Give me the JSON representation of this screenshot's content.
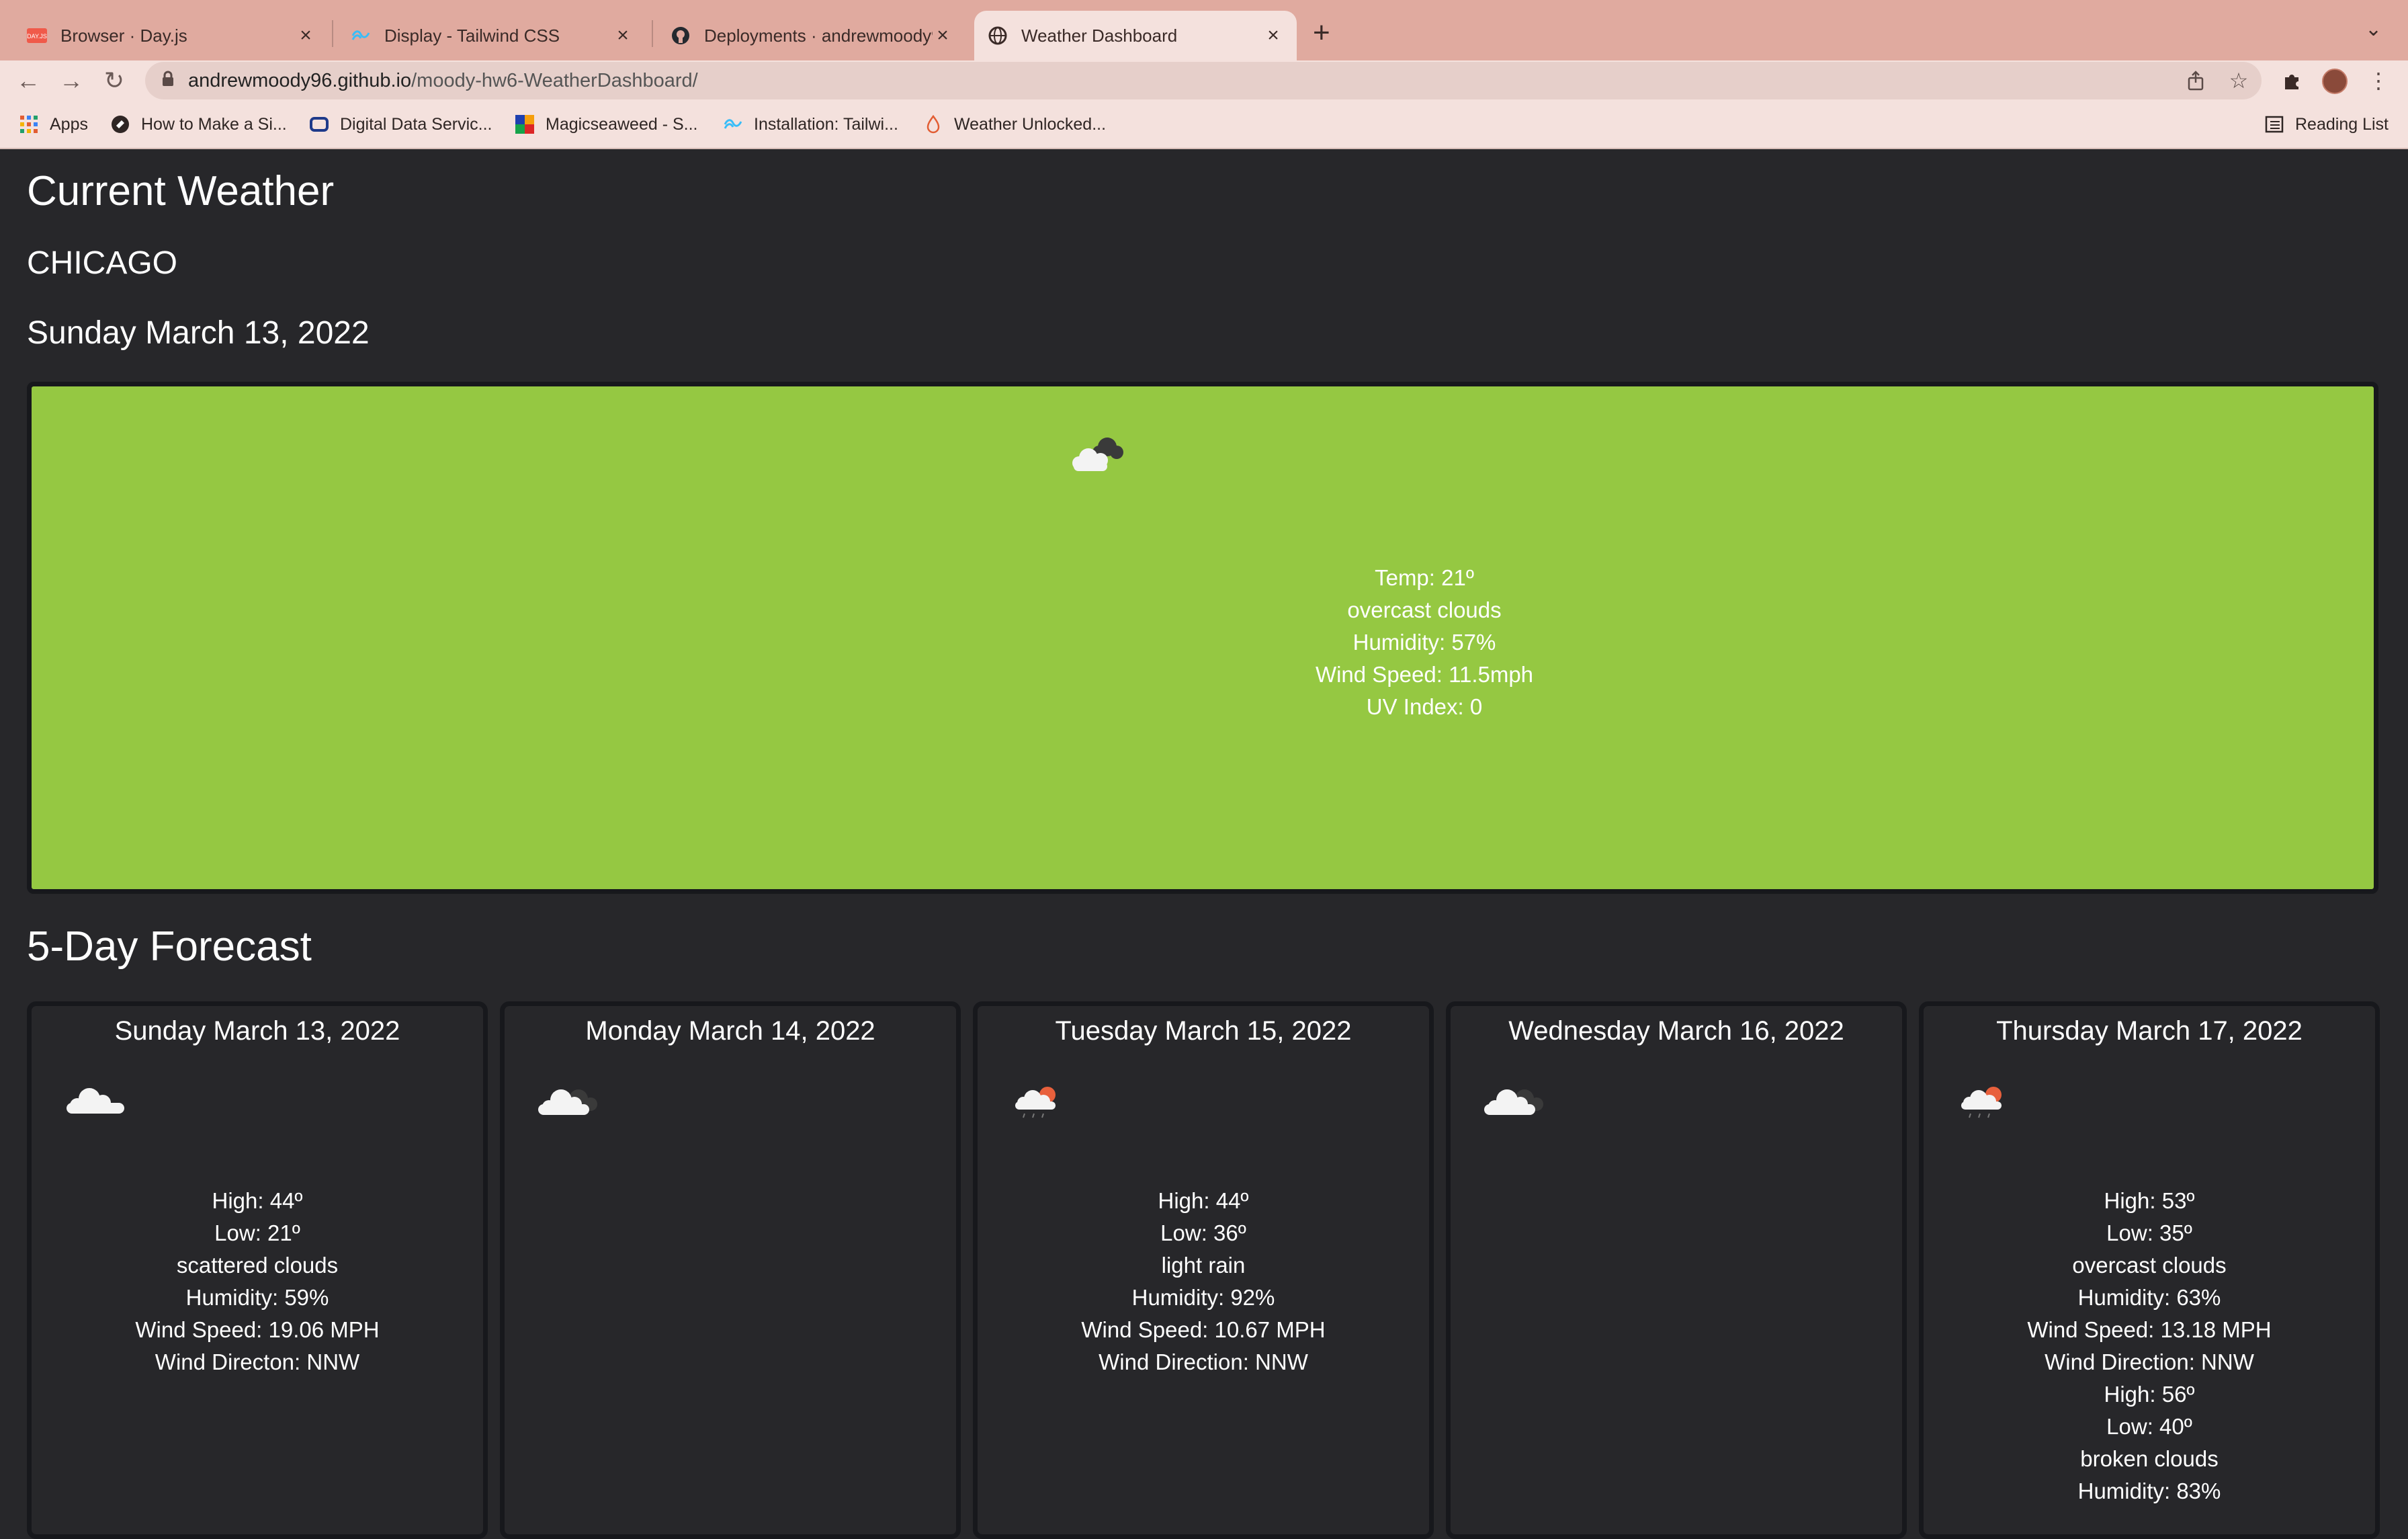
{
  "browser": {
    "tabs": [
      {
        "title": "Browser · Day.js",
        "favicon": "dayjs-icon"
      },
      {
        "title": "Display - Tailwind CSS",
        "favicon": "tailwind-icon"
      },
      {
        "title": "Deployments · andrewmoody96",
        "favicon": "github-icon"
      },
      {
        "title": "Weather Dashboard",
        "favicon": "globe-icon",
        "active": true
      }
    ],
    "url_host": "andrewmoody96.github.io",
    "url_path": "/moody-hw6-WeatherDashboard/",
    "bookmarks": [
      {
        "label": "Apps",
        "icon": "apps-grid-icon"
      },
      {
        "label": "How to Make a Si...",
        "icon": "squarespace-icon"
      },
      {
        "label": "Digital Data Servic...",
        "icon": "ddsi-icon"
      },
      {
        "label": "Magicseaweed - S...",
        "icon": "magicseaweed-icon"
      },
      {
        "label": "Installation: Tailwi...",
        "icon": "tailwind-icon"
      },
      {
        "label": "Weather Unlocked...",
        "icon": "weather-unlocked-icon"
      }
    ],
    "reading_list": "Reading List"
  },
  "page": {
    "heading": "Current Weather",
    "city": "CHICAGO",
    "date": "Sunday March 13, 2022",
    "current": {
      "icon": "overcast-clouds-icon",
      "temp": "Temp: 21º",
      "description": "overcast clouds",
      "humidity": "Humidity: 57%",
      "wind": "Wind Speed: 11.5mph",
      "uv": "UV Index: 0"
    },
    "forecast_heading": "5-Day Forecast",
    "forecast": [
      {
        "date": "Sunday March 13, 2022",
        "icon": "scattered-clouds-icon",
        "lines": [
          "High: 44º",
          "Low: 21º",
          "scattered clouds",
          "Humidity: 59%",
          "Wind Speed: 19.06 MPH",
          "Wind Directon: NNW"
        ]
      },
      {
        "date": "Monday March 14, 2022",
        "icon": "overcast-clouds-icon",
        "lines": []
      },
      {
        "date": "Tuesday March 15, 2022",
        "icon": "light-rain-icon",
        "lines": [
          "High: 44º",
          "Low: 36º",
          "light rain",
          "Humidity: 92%",
          "Wind Speed: 10.67 MPH",
          "Wind Direction: NNW"
        ]
      },
      {
        "date": "Wednesday March 16, 2022",
        "icon": "overcast-clouds-icon",
        "lines": []
      },
      {
        "date": "Thursday March 17, 2022",
        "icon": "light-rain-icon",
        "lines": [
          "High: 53º",
          "Low: 35º",
          "overcast clouds",
          "Humidity: 63%",
          "Wind Speed: 13.18 MPH",
          "Wind Direction: NNW",
          "High: 56º",
          "Low: 40º",
          "broken clouds",
          "Humidity: 83%"
        ]
      }
    ]
  },
  "colors": {
    "page_bg": "#27272a",
    "current_card_bg": "#95c842",
    "card_border": "#17181c",
    "tabstrip_bg": "#e0aa9f",
    "toolbar_bg": "#f4e1dd"
  }
}
